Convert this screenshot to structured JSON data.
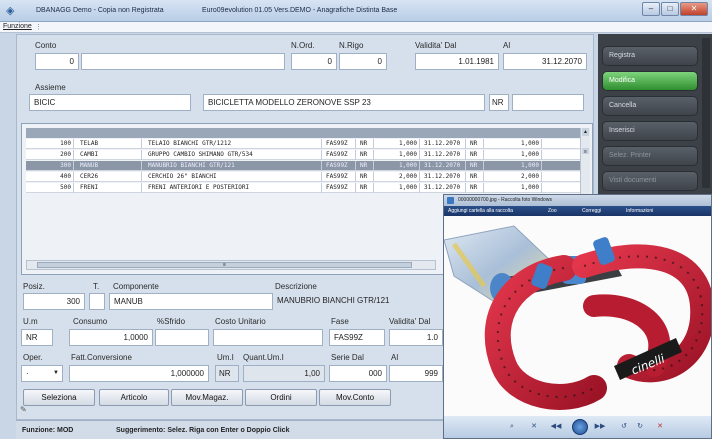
{
  "window": {
    "title_parts": [
      "DBANAGG Demo - Copia non Registrata",
      "Euro09evolution 01.05 Vers.DEMO - Anagrafiche Distinta Base"
    ],
    "minimize": "–",
    "maximize": "□",
    "close": "✕"
  },
  "menu": {
    "item": "Funzione",
    "separator": "⋮"
  },
  "header": {
    "conto_label": "Conto",
    "conto_value": "0",
    "conto_desc": "",
    "nord_label": "N.Ord.",
    "nord_value": "0",
    "nrigo_label": "N.Rigo",
    "nrigo_value": "0",
    "validita_dal_label": "Validita' Dal",
    "validita_dal_value": "1.01.1981",
    "al_label": "Al",
    "al_value": "31.12.2070",
    "assieme_label": "Assieme",
    "assieme_code": "BICIC",
    "assieme_desc": "BICICLETTA MODELLO ZERONOVE SSP 23",
    "nr_value": "NR"
  },
  "grid": {
    "rows": [
      {
        "n": "100",
        "code": "TELAB",
        "desc": "TELAIO BIANCHI GTR/1212",
        "fase": "FAS99Z",
        "um": "NR",
        "qty": "1,000",
        "date": "31.12.2070",
        "um2": "NR",
        "qty2": "1,000",
        "selected": false
      },
      {
        "n": "200",
        "code": "CAMBI",
        "desc": "GRUPPO CAMBIO SHIMANO GTR/534",
        "fase": "FAS99Z",
        "um": "NR",
        "qty": "1,000",
        "date": "31.12.2070",
        "um2": "NR",
        "qty2": "1,000",
        "selected": false
      },
      {
        "n": "300",
        "code": "MANUB",
        "desc": "MANUBRIO BIANCHI GTR/121",
        "fase": "FAS99Z",
        "um": "NR",
        "qty": "1,000",
        "date": "31.12.2070",
        "um2": "NR",
        "qty2": "1,000",
        "selected": true
      },
      {
        "n": "400",
        "code": "CER26",
        "desc": "CERCHIO 26\" BIANCHI",
        "fase": "FAS99Z",
        "um": "NR",
        "qty": "2,000",
        "date": "31.12.2070",
        "um2": "NR",
        "qty2": "2,000",
        "selected": false
      },
      {
        "n": "500",
        "code": "FRENI",
        "desc": "FRENI ANTERIORI E POSTERIORI",
        "fase": "FAS99Z",
        "um": "NR",
        "qty": "1,000",
        "date": "31.12.2070",
        "um2": "NR",
        "qty2": "1,000",
        "selected": false
      }
    ],
    "scroll_up": "▲",
    "scroll_down": "▼",
    "thumb_grip": "≡"
  },
  "detail": {
    "posiz_label": "Posiz.",
    "posiz_value": "300",
    "t_label": "T.",
    "t_value": "",
    "componente_label": "Componente",
    "componente_value": "MANUB",
    "descrizione_label": "Descrizione",
    "descrizione_value": "MANUBRIO BIANCHI GTR/121",
    "um_label": "U.m",
    "um_value": "NR",
    "consumo_label": "Consumo",
    "consumo_value": "1,0000",
    "sfrido_label": "%Sfrido",
    "sfrido_value": "",
    "costo_label": "Costo Unitario",
    "costo_value": "",
    "fase_label": "Fase",
    "fase_value": "FAS99Z",
    "validita_label": "Validita' Dal",
    "validita_value": "1.0",
    "oper_label": "Oper.",
    "oper_value": "·",
    "fatt_label": "Fatt.Conversione",
    "fatt_value": "1,000000",
    "umi_label": "Um.I",
    "umi_value": "NR",
    "quant_label": "Quant.Um.I",
    "quant_value": "1,00",
    "serie_label": "Serie Dal",
    "serie_value": "000",
    "al_label": "Al",
    "al_value": "999"
  },
  "buttons": {
    "seleziona": "Seleziona",
    "articolo": "Articolo",
    "movmagaz": "Mov.Magaz.",
    "ordini": "Ordini",
    "movconto": "Mov.Conto"
  },
  "status": {
    "funzione": "Funzione: MOD",
    "suggerimento": "Suggerimento:  Selez. Riga con Enter o Doppio Click"
  },
  "sidebar": {
    "items": [
      {
        "label": "Registra",
        "state": "normal"
      },
      {
        "label": "Modifica",
        "state": "active"
      },
      {
        "label": "Cancella",
        "state": "normal"
      },
      {
        "label": "Inserisci",
        "state": "normal"
      },
      {
        "label": "Selez. Printer",
        "state": "disabled"
      },
      {
        "label": "Visti documenti",
        "state": "disabled"
      }
    ]
  },
  "viewer": {
    "title": "00000000700.jpg - Raccolta foto Windows",
    "toolbar": [
      "Aggiungi cartella alla raccolta",
      "Zoo",
      "Correggi",
      "Informazioni"
    ],
    "brand": "cinelli",
    "nav": [
      "⌕",
      "✕",
      "◀◀",
      "▶▶",
      "↺",
      "↻",
      "✕"
    ]
  },
  "colors": {
    "accent_green": "#3fa33c",
    "bar_tape_red": "#c8243a",
    "clamp_blue": "#3f7fc9",
    "sidebar_bg": "#3c4147"
  }
}
